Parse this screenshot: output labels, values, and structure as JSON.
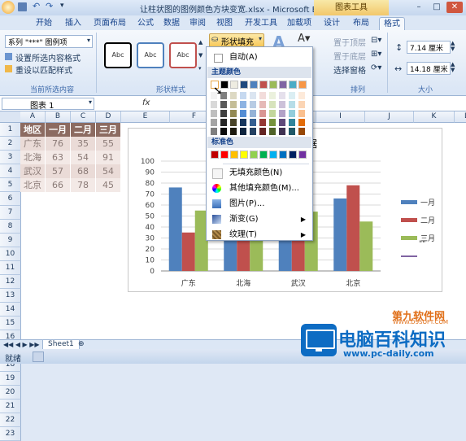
{
  "window": {
    "title": "让柱状图的图例颜色方块变宽.xlsx - Microsoft Ex...",
    "context_tab_group": "图表工具",
    "controls": [
      "–",
      "□",
      "✕"
    ]
  },
  "tabs": [
    "开始",
    "插入",
    "页面布局",
    "公式",
    "数据",
    "审阅",
    "视图",
    "开发工具",
    "加载项",
    "设计",
    "布局",
    "格式"
  ],
  "active_tab": "格式",
  "ribbon": {
    "selection_box": "系列 \"***\" 图例项",
    "format_selection": "设置所选内容格式",
    "reset_style": "重设以匹配样式",
    "group_current": "当前所选内容",
    "shape_samples": [
      "Abc",
      "Abc",
      "Abc"
    ],
    "group_shape_styles": "形状样式",
    "shape_fill_btn": "形状填充",
    "wordart_a": "A",
    "bring_front": "置于顶层",
    "send_back": "置于底层",
    "selection_pane": "选择窗格",
    "group_arrange": "排列",
    "height_value": "7.14 厘米",
    "width_value": "14.18 厘米",
    "group_size": "大小"
  },
  "formula_bar": {
    "name_box": "图表 1",
    "fx": "fx"
  },
  "columns": [
    "A",
    "B",
    "C",
    "D",
    "E",
    "F",
    "G",
    "H",
    "I",
    "J",
    "K",
    "L"
  ],
  "rows": [
    "1",
    "2",
    "3",
    "4",
    "5",
    "6",
    "7",
    "8",
    "9",
    "10",
    "11",
    "12",
    "13",
    "14",
    "15",
    "16",
    "17",
    "18",
    "19",
    "20",
    "21",
    "22",
    "23"
  ],
  "table": {
    "header": [
      "地区",
      "一月",
      "二月",
      "三月"
    ],
    "rows": [
      [
        "广东",
        "76",
        "35",
        "55"
      ],
      [
        "北海",
        "63",
        "54",
        "91"
      ],
      [
        "武汉",
        "57",
        "68",
        "54"
      ],
      [
        "北京",
        "66",
        "78",
        "45"
      ]
    ]
  },
  "chart_data": {
    "type": "bar",
    "title_fragment": "据",
    "categories": [
      "广东",
      "北海",
      "武汉",
      "北京"
    ],
    "series": [
      {
        "name": "一月",
        "values": [
          76,
          63,
          57,
          66
        ],
        "color": "#4f81bd"
      },
      {
        "name": "二月",
        "values": [
          35,
          54,
          68,
          78
        ],
        "color": "#c0504d"
      },
      {
        "name": "三月",
        "values": [
          55,
          91,
          54,
          45
        ],
        "color": "#9bbb59"
      }
    ],
    "legend_extra": "\"\"",
    "yticks": [
      "100",
      "90",
      "80",
      "70",
      "60",
      "50",
      "40",
      "30",
      "20",
      "10",
      "0"
    ],
    "ylim": [
      0,
      100
    ],
    "legend": "right"
  },
  "dropdown": {
    "auto": "自动(A)",
    "theme_colors_label": "主题颜色",
    "standard_colors_label": "标准色",
    "no_fill": "无填充颜色(N)",
    "more_colors": "其他填充颜色(M)...",
    "picture": "图片(P)...",
    "gradient": "渐变(G)",
    "texture": "纹理(T)",
    "theme_top": [
      "#ffffff",
      "#000000",
      "#eeece1",
      "#1f497d",
      "#4f81bd",
      "#c0504d",
      "#9bbb59",
      "#8064a2",
      "#4bacc6",
      "#f79646"
    ],
    "theme_shades": [
      [
        "#f2f2f2",
        "#7f7f7f",
        "#ddd9c3",
        "#c6d9f0",
        "#dbe5f1",
        "#f2dcdb",
        "#ebf1dd",
        "#e5e0ec",
        "#dbeef3",
        "#fdeada"
      ],
      [
        "#d8d8d8",
        "#595959",
        "#c4bd97",
        "#8db3e2",
        "#b8cce4",
        "#e5b9b7",
        "#d7e3bc",
        "#ccc1d9",
        "#b7dde8",
        "#fbd5b5"
      ],
      [
        "#bfbfbf",
        "#3f3f3f",
        "#938953",
        "#548dd4",
        "#95b3d7",
        "#d99694",
        "#c3d69b",
        "#b2a2c7",
        "#92cddc",
        "#fac08f"
      ],
      [
        "#a5a5a5",
        "#262626",
        "#494429",
        "#17365d",
        "#366092",
        "#953734",
        "#76923c",
        "#5f497a",
        "#31859b",
        "#e36c09"
      ],
      [
        "#7f7f7f",
        "#0c0c0c",
        "#1d1b10",
        "#0f243e",
        "#244061",
        "#632423",
        "#4f6128",
        "#3f3151",
        "#205867",
        "#974806"
      ]
    ],
    "standard": [
      "#c00000",
      "#ff0000",
      "#ffc000",
      "#ffff00",
      "#92d050",
      "#00b050",
      "#00b0f0",
      "#0070c0",
      "#002060",
      "#7030a0"
    ]
  },
  "sheet_tab": "Sheet1",
  "status": "就绪",
  "watermark": {
    "top": "第九软件网",
    "top_url": "WWW.D9SOFT.COM",
    "main": "电脑百科知识",
    "url": "www.pc-daily.com"
  }
}
